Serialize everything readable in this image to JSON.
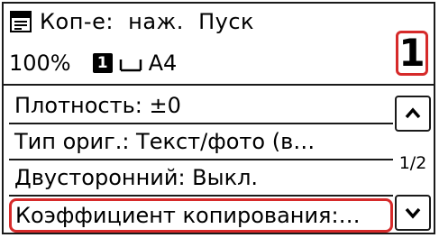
{
  "header": {
    "status_text": "Коп-е:  наж.  Пуск",
    "zoom": "100%",
    "tray_number": "1",
    "paper_size": "A4",
    "copies": "1"
  },
  "menu": {
    "items": [
      {
        "label": "Плотность:  ±0"
      },
      {
        "label": "Тип  ориг.:  Текст/фото  (в…"
      },
      {
        "label": "Двусторонний:  Выкл."
      },
      {
        "label": "Коэффициент  копирования:…"
      }
    ],
    "selected_index": 3
  },
  "scroller": {
    "page": "1/2",
    "up_icon": "chevron-up-icon",
    "down_icon": "chevron-down-icon"
  },
  "colors": {
    "highlight": "#d62a2a",
    "frame": "#1a1a1a"
  }
}
